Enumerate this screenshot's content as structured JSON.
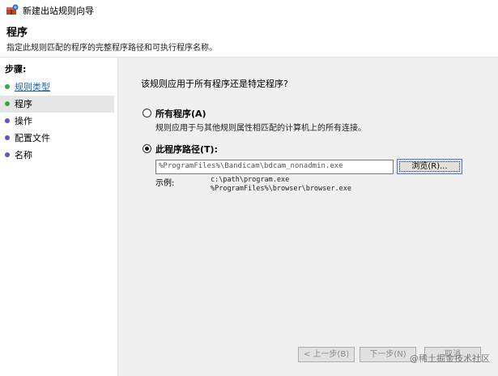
{
  "window": {
    "title": "新建出站规则向导"
  },
  "header": {
    "title": "程序",
    "description": "指定此规则匹配的程序的完整程序路径和可执行程序名称。"
  },
  "sidebar": {
    "heading": "步骤:",
    "items": [
      {
        "label": "规则类型",
        "state": "done",
        "dot_color": "#3aa93a"
      },
      {
        "label": "程序",
        "state": "active",
        "dot_color": "#3aa93a"
      },
      {
        "label": "操作",
        "state": "pending",
        "dot_color": "#6a4fc8"
      },
      {
        "label": "配置文件",
        "state": "pending",
        "dot_color": "#6a4fc8"
      },
      {
        "label": "名称",
        "state": "pending",
        "dot_color": "#6a4fc8"
      }
    ]
  },
  "main": {
    "question": "该规则应用于所有程序还是特定程序?",
    "all_programs": {
      "label": "所有程序(A)",
      "description": "规则应用于与其他规则属性相匹配的计算机上的所有连接。",
      "checked": false
    },
    "this_program": {
      "label": "此程序路径(T):",
      "checked": true,
      "path_value": "%ProgramFiles%\\Bandicam\\bdcam_nonadmin.exe",
      "browse_label": "浏览(R)...",
      "example_label": "示例:",
      "examples": [
        "c:\\path\\program.exe",
        "%ProgramFiles%\\browser\\browser.exe"
      ]
    }
  },
  "footer": {
    "back_label": "< 上一步(B)",
    "next_label": "下一步(N)",
    "cancel_label": "取消"
  },
  "watermark": "@稀土掘金技术社区"
}
